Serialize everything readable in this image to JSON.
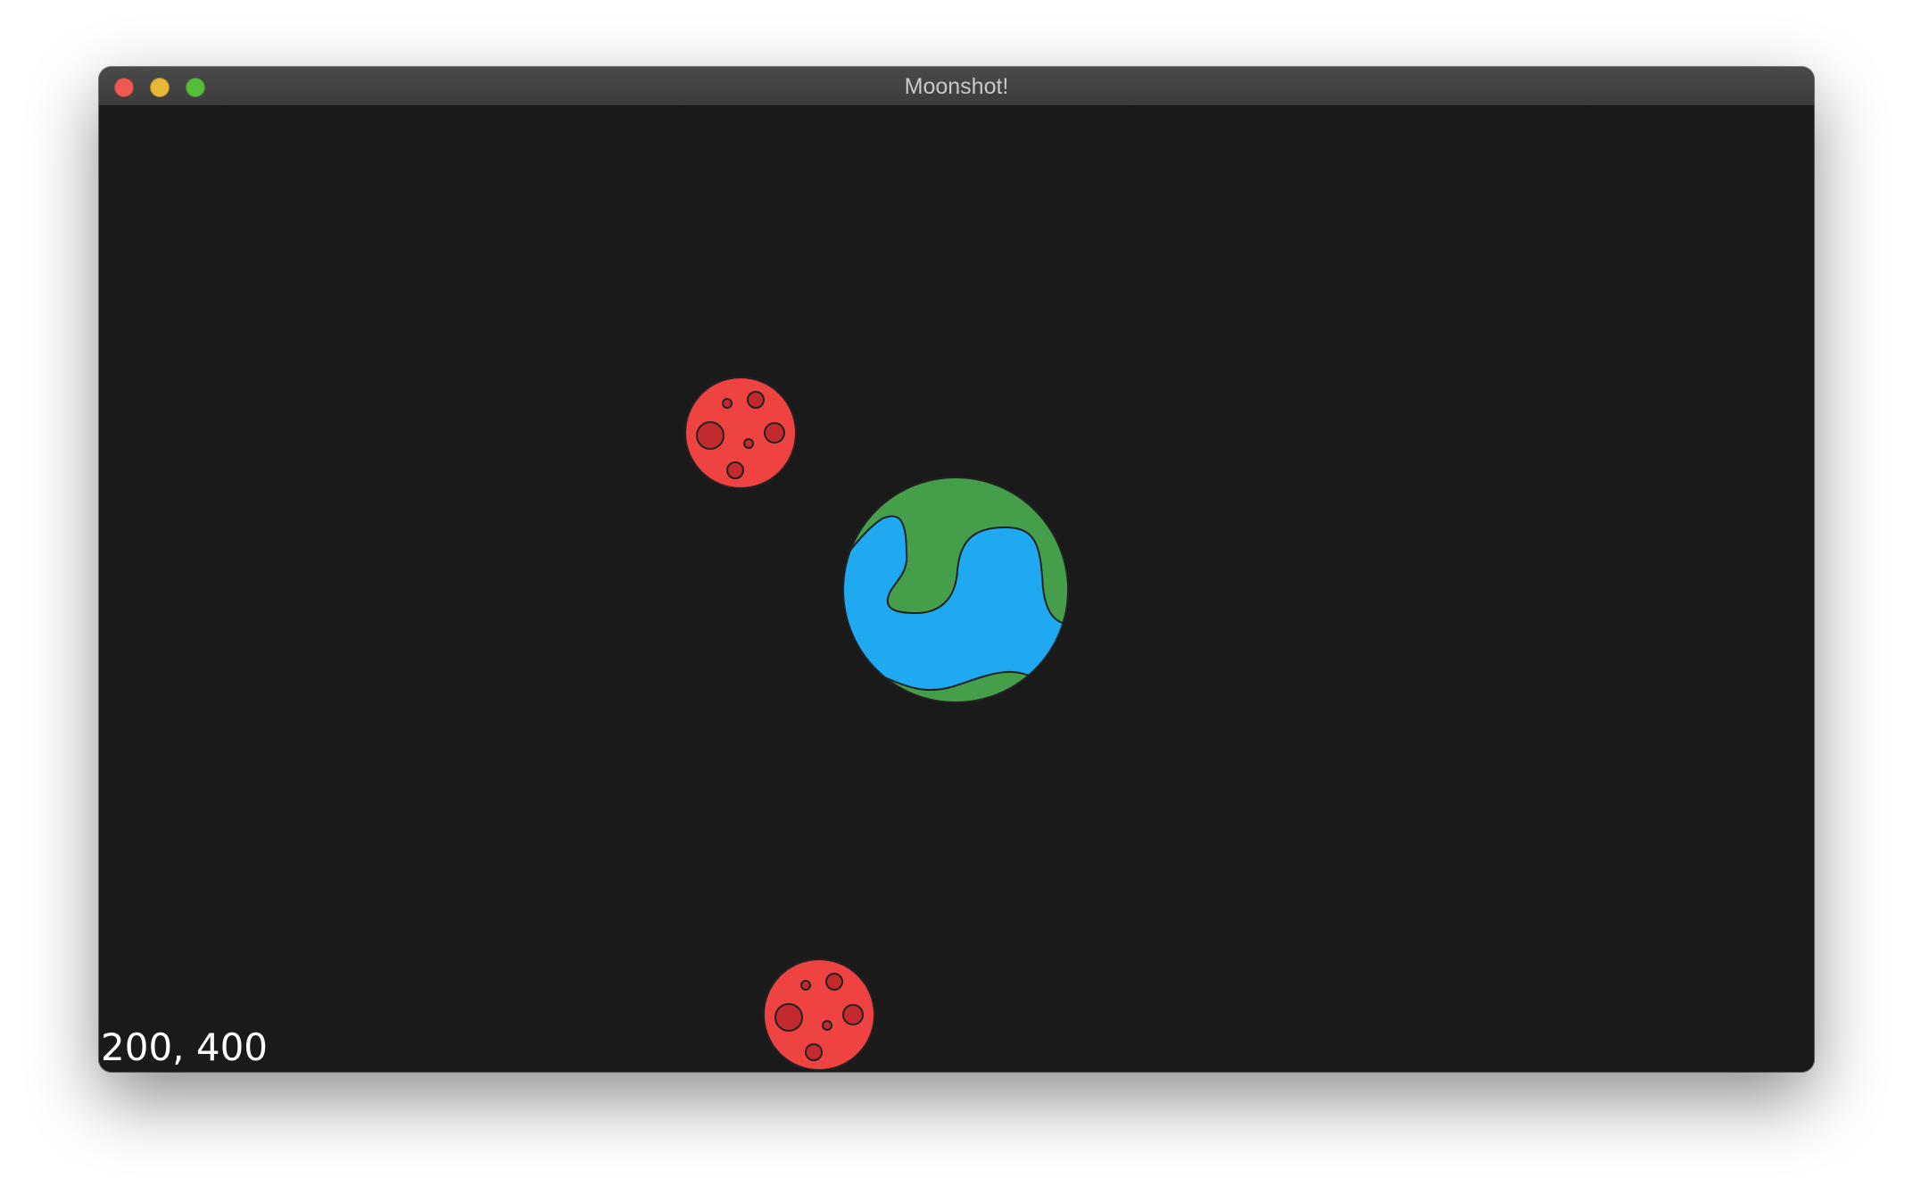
{
  "window": {
    "title": "Moonshot!",
    "controls": {
      "close_color": "#ee5a53",
      "minimize_color": "#e6b93a",
      "zoom_color": "#55bd3a"
    }
  },
  "game": {
    "background_color": "#1a1a1a",
    "coordinates_text": "200, 400",
    "earth": {
      "ocean_color": "#1fa9f0",
      "land_color": "#459f4a"
    },
    "moons": [
      {
        "name": "moon-upper",
        "color": "#ee4340",
        "crater_color": "#c22a2e"
      },
      {
        "name": "moon-lower",
        "color": "#ee4340",
        "crater_color": "#c22a2e"
      }
    ]
  }
}
